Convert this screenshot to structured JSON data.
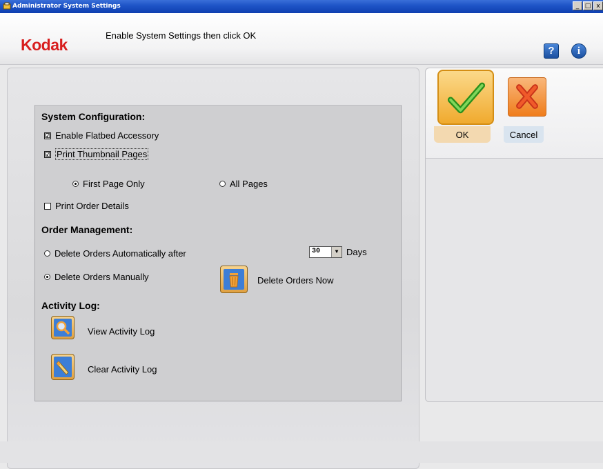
{
  "window": {
    "title": "Administrator System Settings",
    "controls": {
      "minimize": "_",
      "restore": "□",
      "close": "x"
    }
  },
  "header": {
    "logo": "Kodak",
    "instruction": "Enable System Settings then click OK",
    "help_label": "?",
    "info_label": "i"
  },
  "system_configuration": {
    "title": "System Configuration:",
    "enable_flatbed": {
      "label": "Enable Flatbed Accessory",
      "checked": true
    },
    "print_thumbnail": {
      "label": "Print Thumbnail Pages",
      "checked": true
    },
    "thumbnail_options": [
      {
        "label": "First Page Only",
        "selected": true
      },
      {
        "label": "All Pages",
        "selected": false
      }
    ],
    "print_order_details": {
      "label": "Print Order Details",
      "checked": false
    }
  },
  "order_management": {
    "title": "Order Management:",
    "delete_auto": {
      "label": "Delete Orders Automatically after",
      "selected": false
    },
    "days_value": "30",
    "days_label": "Days",
    "delete_manual": {
      "label": "Delete Orders Manually",
      "selected": true
    },
    "delete_now_label": "Delete Orders Now"
  },
  "activity_log": {
    "title": "Activity Log:",
    "view_label": "View Activity Log",
    "clear_label": "Clear Activity Log"
  },
  "actions": {
    "ok_label": "OK",
    "cancel_label": "Cancel"
  },
  "checkbox_mark": "☑",
  "icons": {
    "ok": "checkmark-icon",
    "cancel": "x-icon",
    "delete_now": "trash-icon",
    "view_log": "magnifier-icon",
    "clear_log": "eraser-icon"
  },
  "colors": {
    "brand": "#d81e1e",
    "titlebar": "#1f55c8",
    "ok_button": "#f0aa2e",
    "cancel_button": "#ef7d1c"
  }
}
